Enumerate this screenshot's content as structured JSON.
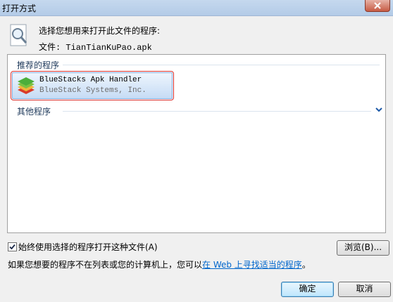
{
  "window": {
    "title": "打开方式"
  },
  "header": {
    "prompt": "选择您想用来打开此文件的程序:",
    "file_label": "文件: TianTianKuPao.apk",
    "icon": "magnifier-document-icon"
  },
  "program_list": {
    "recommended_header": "推荐的程序",
    "other_header": "其他程序",
    "expand_icon": "chevron-down-icon",
    "recommended_items": [
      {
        "name": "BlueStacks Apk Handler",
        "publisher": "BlueStack Systems, Inc.",
        "icon": "bluestacks-icon",
        "selected": true
      }
    ]
  },
  "options": {
    "always_use_label": "始终使用选择的程序打开这种文件(A)",
    "always_use_checked": true,
    "browse_label": "浏览(B)..."
  },
  "info": {
    "text_before_link": "如果您想要的程序不在列表或您的计算机上，您可以",
    "link_text": "在 Web 上寻找适当的程序",
    "text_after_link": "。"
  },
  "buttons": {
    "ok": "确定",
    "cancel": "取消"
  },
  "colors": {
    "selection_outline": "#d9302c",
    "link": "#0066cc",
    "group_header": "#1e395b"
  }
}
